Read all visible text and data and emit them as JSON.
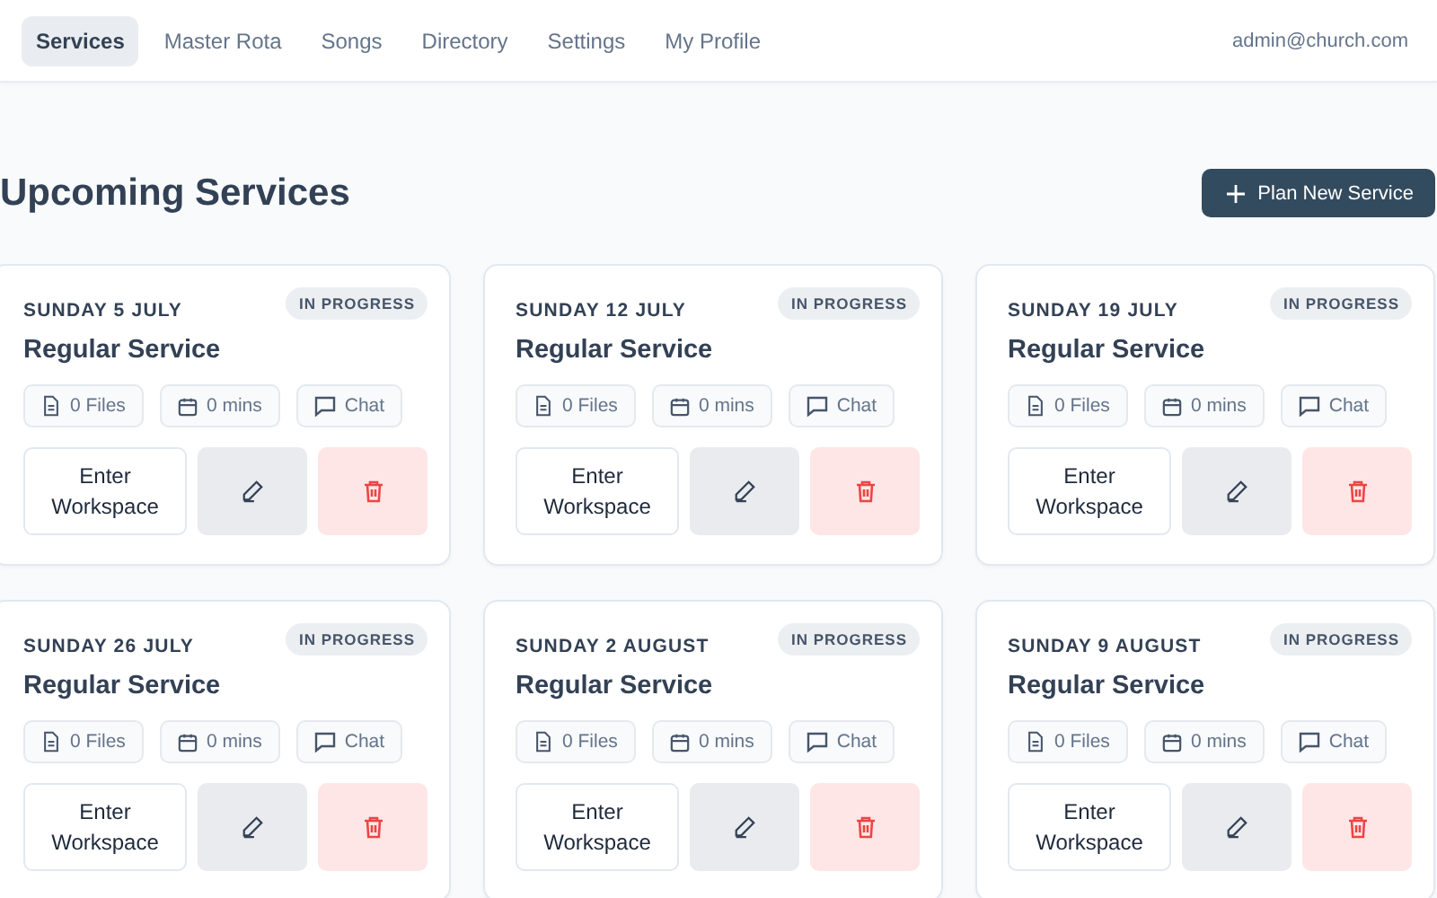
{
  "nav": {
    "tabs": [
      {
        "label": "Services",
        "selected": true
      },
      {
        "label": "Master Rota",
        "selected": false
      },
      {
        "label": "Songs",
        "selected": false
      },
      {
        "label": "Directory",
        "selected": false
      },
      {
        "label": "Settings",
        "selected": false
      },
      {
        "label": "My Profile",
        "selected": false
      }
    ],
    "user_email": "admin@church.com"
  },
  "heading": "Upcoming Services",
  "plan_button": "Plan New Service",
  "services": [
    {
      "date": "SUNDAY 5 JULY",
      "status": "IN PROGRESS",
      "title": "Regular Service",
      "files": "0 Files",
      "duration": "0 mins",
      "chat": "Chat",
      "enter": "Enter Workspace"
    },
    {
      "date": "SUNDAY 12 JULY",
      "status": "IN PROGRESS",
      "title": "Regular Service",
      "files": "0 Files",
      "duration": "0 mins",
      "chat": "Chat",
      "enter": "Enter Workspace"
    },
    {
      "date": "SUNDAY 19 JULY",
      "status": "IN PROGRESS",
      "title": "Regular Service",
      "files": "0 Files",
      "duration": "0 mins",
      "chat": "Chat",
      "enter": "Enter Workspace"
    },
    {
      "date": "SUNDAY 26 JULY",
      "status": "IN PROGRESS",
      "title": "Regular Service",
      "files": "0 Files",
      "duration": "0 mins",
      "chat": "Chat",
      "enter": "Enter Workspace"
    },
    {
      "date": "SUNDAY 2 AUGUST",
      "status": "IN PROGRESS",
      "title": "Regular Service",
      "files": "0 Files",
      "duration": "0 mins",
      "chat": "Chat",
      "enter": "Enter Workspace"
    },
    {
      "date": "SUNDAY 9 AUGUST",
      "status": "IN PROGRESS",
      "title": "Regular Service",
      "files": "0 Files",
      "duration": "0 mins",
      "chat": "Chat",
      "enter": "Enter Workspace"
    }
  ]
}
